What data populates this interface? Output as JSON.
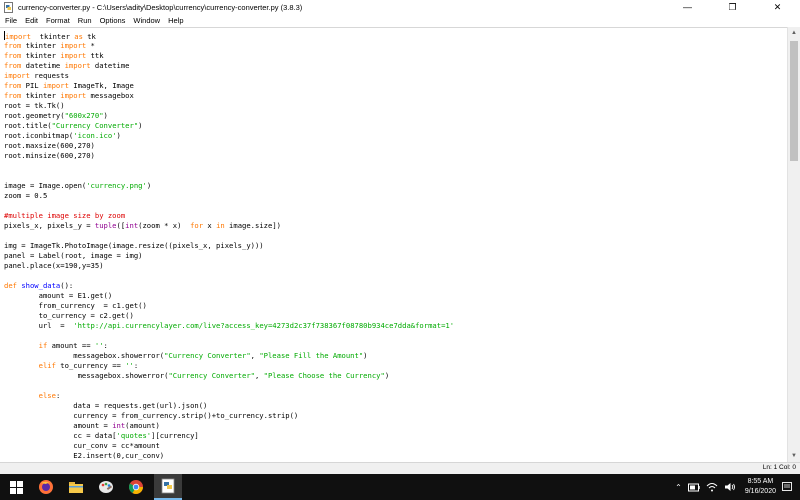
{
  "window": {
    "title": "currency-converter.py - C:\\Users\\adity\\Desktop\\currency\\currency-converter.py (3.8.3)",
    "minimize_glyph": "—",
    "maximize_glyph": "❐",
    "close_glyph": "✕"
  },
  "menu": {
    "items": [
      "File",
      "Edit",
      "Format",
      "Run",
      "Options",
      "Window",
      "Help"
    ]
  },
  "code": {
    "lines": [
      [
        [
          "kw",
          "import"
        ],
        [
          "",
          "  tkinter "
        ],
        [
          "kw",
          "as"
        ],
        [
          "",
          " tk"
        ]
      ],
      [
        [
          "kw",
          "from"
        ],
        [
          "",
          " tkinter "
        ],
        [
          "kw",
          "import"
        ],
        [
          "",
          " *"
        ]
      ],
      [
        [
          "kw",
          "from"
        ],
        [
          "",
          " tkinter "
        ],
        [
          "kw",
          "import"
        ],
        [
          "",
          " ttk"
        ]
      ],
      [
        [
          "kw",
          "from"
        ],
        [
          "",
          " datetime "
        ],
        [
          "kw",
          "import"
        ],
        [
          "",
          " datetime"
        ]
      ],
      [
        [
          "kw",
          "import"
        ],
        [
          "",
          " requests"
        ]
      ],
      [
        [
          "kw",
          "from"
        ],
        [
          "",
          " PIL "
        ],
        [
          "kw",
          "import"
        ],
        [
          "",
          " ImageTk, Image"
        ]
      ],
      [
        [
          "kw",
          "from"
        ],
        [
          "",
          " tkinter "
        ],
        [
          "kw",
          "import"
        ],
        [
          "",
          " messagebox"
        ]
      ],
      [
        [
          "",
          "root = tk.Tk()"
        ]
      ],
      [
        [
          "",
          "root.geometry("
        ],
        [
          "str",
          "\"600x270\""
        ],
        [
          "",
          ")"
        ]
      ],
      [
        [
          "",
          "root.title("
        ],
        [
          "str",
          "\"Currency Converter\""
        ],
        [
          "",
          ")"
        ]
      ],
      [
        [
          "",
          "root.iconbitmap("
        ],
        [
          "str",
          "'icon.ico'"
        ],
        [
          "",
          ")"
        ]
      ],
      [
        [
          "",
          "root.maxsize(600,270)"
        ]
      ],
      [
        [
          "",
          "root.minsize(600,270)"
        ]
      ],
      [],
      [],
      [
        [
          "",
          "image = Image.open("
        ],
        [
          "str",
          "'currency.png'"
        ],
        [
          "",
          ")"
        ]
      ],
      [
        [
          "",
          "zoom = 0.5"
        ]
      ],
      [],
      [
        [
          "cm",
          "#multiple image size by zoom"
        ]
      ],
      [
        [
          "",
          "pixels_x, pixels_y = "
        ],
        [
          "bi",
          "tuple"
        ],
        [
          "",
          "(["
        ],
        [
          "bi",
          "int"
        ],
        [
          "",
          "(zoom * x)  "
        ],
        [
          "kw",
          "for"
        ],
        [
          "",
          " x "
        ],
        [
          "kw",
          "in"
        ],
        [
          "",
          " image.size])"
        ]
      ],
      [],
      [
        [
          "",
          "img = ImageTk.PhotoImage(image.resize((pixels_x, pixels_y)))"
        ]
      ],
      [
        [
          "",
          "panel = Label(root, image = img)"
        ]
      ],
      [
        [
          "",
          "panel.place(x=190,y=35)"
        ]
      ],
      [],
      [
        [
          "kw",
          "def"
        ],
        [
          "",
          " "
        ],
        [
          "def",
          "show_data"
        ],
        [
          "",
          "():"
        ]
      ],
      [
        [
          "",
          "        amount = E1.get()"
        ]
      ],
      [
        [
          "",
          "        from_currency  = c1.get()"
        ]
      ],
      [
        [
          "",
          "        to_currency = c2.get()"
        ]
      ],
      [
        [
          "",
          "        url  =  "
        ],
        [
          "str",
          "'http://api.currencylayer.com/live?access_key=4273d2c37f738367f08780b934ce7dda&format=1'"
        ]
      ],
      [],
      [
        [
          "",
          "        "
        ],
        [
          "kw",
          "if"
        ],
        [
          "",
          " amount == "
        ],
        [
          "str",
          "''"
        ],
        [
          "",
          ":"
        ]
      ],
      [
        [
          "",
          "                messagebox.showerror("
        ],
        [
          "str",
          "\"Currency Converter\""
        ],
        [
          "",
          ", "
        ],
        [
          "str",
          "\"Please Fill the Amount\""
        ],
        [
          "",
          ")"
        ]
      ],
      [
        [
          "",
          "        "
        ],
        [
          "kw",
          "elif"
        ],
        [
          "",
          " to_currency == "
        ],
        [
          "str",
          "''"
        ],
        [
          "",
          ":"
        ]
      ],
      [
        [
          "",
          "                 messagebox.showerror("
        ],
        [
          "str",
          "\"Currency Converter\""
        ],
        [
          "",
          ", "
        ],
        [
          "str",
          "\"Please Choose the Currency\""
        ],
        [
          "",
          ")"
        ]
      ],
      [],
      [
        [
          "",
          "        "
        ],
        [
          "kw",
          "else"
        ],
        [
          "",
          ":"
        ]
      ],
      [
        [
          "",
          "                data = requests.get(url).json()"
        ]
      ],
      [
        [
          "",
          "                currency = from_currency.strip()+to_currency.strip()"
        ]
      ],
      [
        [
          "",
          "                amount = "
        ],
        [
          "bi",
          "int"
        ],
        [
          "",
          "(amount)"
        ]
      ],
      [
        [
          "",
          "                cc = data["
        ],
        [
          "str",
          "'quotes'"
        ],
        [
          "",
          "][currency]"
        ]
      ],
      [
        [
          "",
          "                cur_conv = cc*amount"
        ]
      ],
      [
        [
          "",
          "                E2.insert(0,cur_conv)"
        ]
      ]
    ]
  },
  "status": {
    "position": "Ln: 1   Col: 0"
  },
  "taskbar": {
    "time": "8:55 AM",
    "date": "9/16/2020",
    "active_color": "#76b9ed"
  }
}
